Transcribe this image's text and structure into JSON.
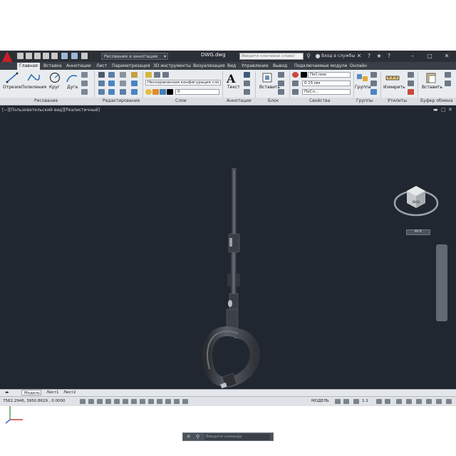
{
  "titlebar": {
    "workspace": "Рисование и аннотации",
    "document_title": "DWG.dwg",
    "search_placeholder": "Введите ключевое слово/фразу",
    "sign_in": "Вход в службы"
  },
  "tabs": [
    "Главная",
    "Вставка",
    "Аннотации",
    "Лист",
    "Параметризация",
    "3D инструменты",
    "Визуализация",
    "Вид",
    "Управление",
    "Вывод",
    "Подключаемые модули",
    "Онлайн"
  ],
  "ribbon": {
    "draw_tools": [
      "Отрезок",
      "Полилиния",
      "Круг",
      "Дуга"
    ],
    "text_tool": "Текст",
    "insert_tool": "Вставить",
    "group_tool": "Группа",
    "measure_tool": "Измерить",
    "paste_tool": "Вставить",
    "layer_state": "Несохраненная конфигурация сло",
    "layer_current": "0",
    "prop_color": "ПоСлою",
    "prop_lineweight": "0.15 мм",
    "prop_linetype": "ПоСл...",
    "panels": [
      "Рисование",
      "Редактирование",
      "Слои",
      "Аннотации",
      "Блок",
      "Свойства",
      "Группы",
      "Утилиты",
      "Буфер обмена"
    ]
  },
  "viewport": {
    "label": "[−][Пользовательский вид][Реалистичный]",
    "viewcube_face": "ВИД",
    "wcs_label": "МСК",
    "command_placeholder": "Введите команду"
  },
  "layout_tabs": [
    "Модель",
    "Лист1",
    "Лист2"
  ],
  "status": {
    "coords": "7562.2946, 3950.8629 , 0.0000",
    "space": "МОДЕЛЬ",
    "scale": "1:1"
  },
  "colors": {
    "titlebar": "#2b2f36",
    "ribbon": "#e9ecef",
    "viewport": "#212730",
    "model_part": "#4a4e55",
    "brand": "#c8202a"
  }
}
